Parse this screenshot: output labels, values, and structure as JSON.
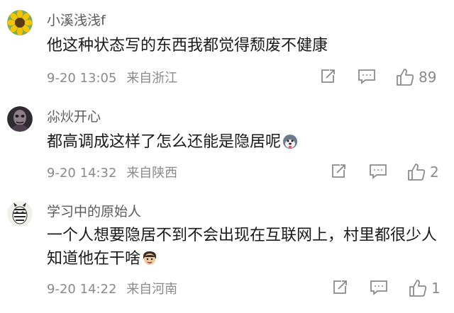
{
  "comments": [
    {
      "username": "小溪浅浅f",
      "avatar": "sunflower",
      "content": "他这种状态写的东西我都觉得颓废不健康",
      "date": "9-20 13:05",
      "location": "来自浙江",
      "likes": "89"
    },
    {
      "username": "尛炏开心",
      "avatar": "dark-figure",
      "content": "都高调成这样了怎么还能是隐居呢",
      "emoji": "husky-face",
      "date": "9-20 14:32",
      "location": "来自陕西",
      "likes": "2"
    },
    {
      "username": "学习中的原始人",
      "avatar": "zebra",
      "content": "一个人想要隐居不到不会出现在互联网上，村里都很少人知道他在干啥",
      "emoji": "face-with-hand",
      "date": "9-20 14:22",
      "location": "来自河南",
      "likes": "1"
    }
  ],
  "icons": {
    "share": "share-icon",
    "comment": "comment-icon",
    "like": "thumbs-up-icon"
  }
}
